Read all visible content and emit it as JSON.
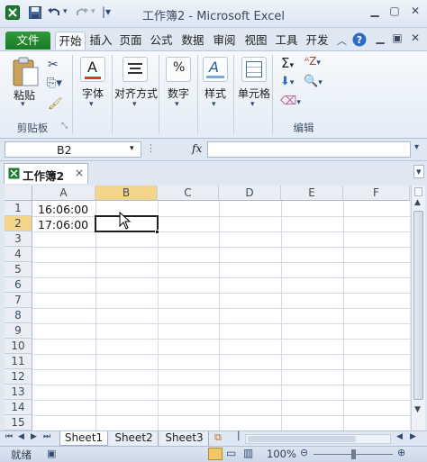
{
  "titlebar": {
    "title": "工作簿2 - Microsoft Excel",
    "app_icon": "excel-icon",
    "quick_access": [
      "save-icon",
      "undo-icon",
      "redo-icon",
      "customize-icon"
    ],
    "window_controls": [
      "minimize-icon",
      "restore-icon",
      "close-icon"
    ]
  },
  "ribbon_tabs": [
    "文件",
    "开始",
    "插入",
    "页面",
    "公式",
    "数据",
    "审阅",
    "视图",
    "工具",
    "开发"
  ],
  "ribbon": {
    "clipboard": {
      "paste": "粘贴",
      "group_label": "剪贴板"
    },
    "font": {
      "label": "字体"
    },
    "alignment": {
      "label": "对齐方式"
    },
    "number": {
      "label": "数字"
    },
    "styles": {
      "label": "样式"
    },
    "cells": {
      "label": "单元格"
    },
    "editing": {
      "group_label": "编辑"
    }
  },
  "formula_bar": {
    "name_box": "B2",
    "fx": "fx",
    "value": ""
  },
  "workbook": {
    "tab_title": "工作簿2",
    "close": "×"
  },
  "columns": [
    "A",
    "B",
    "C",
    "D",
    "E",
    "F"
  ],
  "rows": [
    "1",
    "2",
    "3",
    "4",
    "5",
    "6",
    "7",
    "8",
    "9",
    "10",
    "11",
    "12",
    "13",
    "14",
    "15"
  ],
  "cells": {
    "A1": "16:06:00",
    "A2": "17:06:00"
  },
  "sheets": [
    "Sheet1",
    "Sheet2",
    "Sheet3"
  ],
  "status": {
    "mode": "就绪",
    "zoom": "100%"
  },
  "colors": {
    "file_tab": "#1c7a26",
    "accent": "#3a6fb0"
  }
}
